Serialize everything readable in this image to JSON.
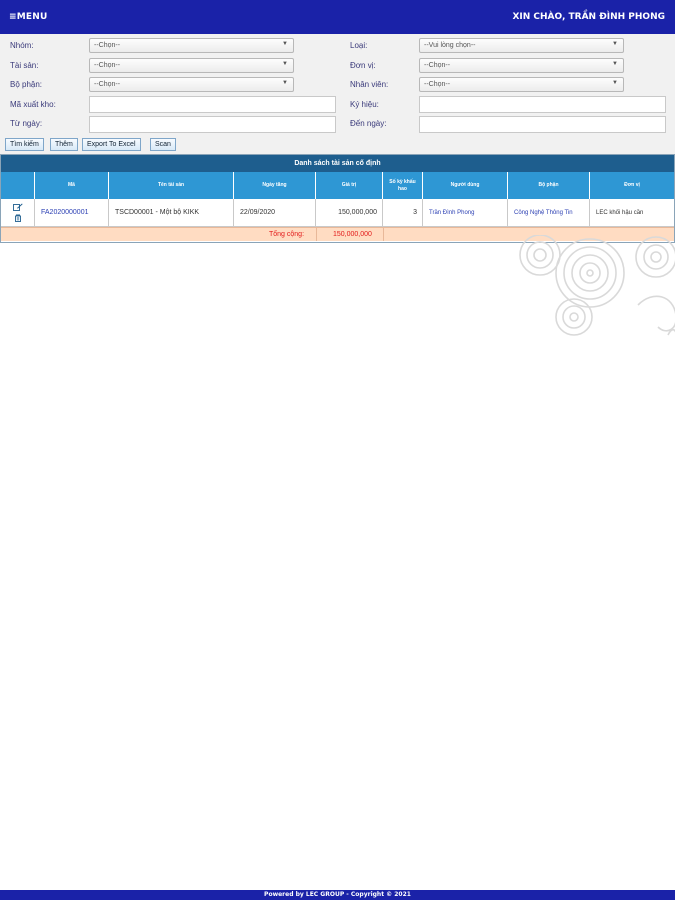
{
  "header": {
    "menu_label": "≡MENU",
    "greeting": "XIN CHÀO, TRẦN ĐÌNH PHONG",
    "bar_color": "#1a22a8"
  },
  "filters": {
    "left": [
      {
        "label": "Nhóm:",
        "value": "--Chọn--"
      },
      {
        "label": "Tài sản:",
        "value": "--Chọn--"
      },
      {
        "label": "Bộ phận:",
        "value": "--Chọn--"
      },
      {
        "label": "Mã xuất kho:",
        "value": ""
      },
      {
        "label": "Từ ngày:",
        "value": ""
      }
    ],
    "right": [
      {
        "label": "Loại:",
        "value": "--Vui lòng chọn--"
      },
      {
        "label": "Đơn vị:",
        "value": "--Chọn--"
      },
      {
        "label": "Nhân viên:",
        "value": "--Chọn--"
      },
      {
        "label": "Ký hiệu:",
        "value": ""
      },
      {
        "label": "Đến ngày:",
        "value": ""
      }
    ]
  },
  "buttons": {
    "search": "Tìm kiếm",
    "add": "Thêm",
    "export": "Export To Excel",
    "scan": "Scan"
  },
  "grid": {
    "title": "Danh sách tài sản cố định",
    "columns": [
      "",
      "Mã",
      "Tên tài sản",
      "Ngày tăng",
      "Giá trị",
      "Số kỳ khấu hao",
      "Người dùng",
      "Bộ phận",
      "Đơn vị"
    ],
    "rows": [
      {
        "code": "FA2020000001",
        "name": "TSCD00001 - Một bộ KIKK",
        "date": "22/09/2020",
        "value": "150,000,000",
        "periods": "3",
        "user": "Trần Đình Phong",
        "department": "Công Nghệ Thông Tin",
        "unit": "LEC khối hậu cần"
      }
    ],
    "total_label": "Tổng cộng:",
    "total_value": "150,000,000"
  },
  "footer": {
    "text": "Powered by LEC GROUP - Copyright © 2021"
  },
  "icons": [
    "edit-icon",
    "trash-icon",
    "dropdown-arrow-icon",
    "swirl-decoration"
  ],
  "colors": {
    "header_blue": "#1a22a8",
    "grid_title": "#1e5e8e",
    "grid_header": "#2e97d4",
    "total_row": "#ffdcc2",
    "total_text": "#e21a1a",
    "link": "#2b3fb3"
  }
}
